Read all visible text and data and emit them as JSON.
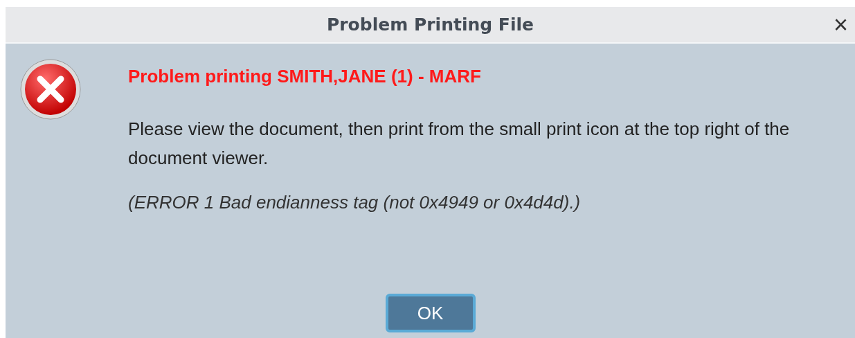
{
  "window": {
    "title": "Problem Printing File",
    "close": "×"
  },
  "message": {
    "heading": "Problem printing SMITH,JANE (1) - MARF",
    "body": "Please view the document, then print from the small print icon at the top right of the document viewer.",
    "error": "(ERROR 1 Bad endianness tag (not 0x4949 or 0x4d4d).)"
  },
  "buttons": [
    {
      "label": "OK",
      "focused": true
    }
  ]
}
